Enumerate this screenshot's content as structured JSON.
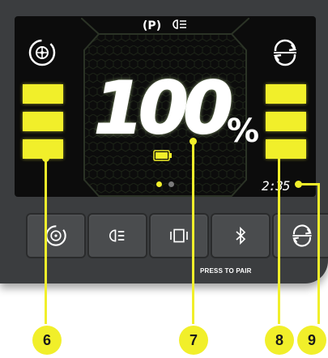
{
  "status": {
    "park": "(P)",
    "light_icon": "headlight-icon"
  },
  "battery": {
    "percent_digits": "100",
    "percent_sign": "%",
    "level": 1.0
  },
  "clock": {
    "time": "2:35"
  },
  "carousel": {
    "dots": [
      {
        "active": true
      },
      {
        "active": false
      }
    ]
  },
  "buttons": [
    {
      "icon": "wheel-cycle-icon"
    },
    {
      "icon": "headlight-icon"
    },
    {
      "icon": "bracket-display-icon"
    },
    {
      "icon": "bluetooth-icon"
    },
    {
      "icon": "rotate-arrows-icon"
    }
  ],
  "pair_label": "PRESS TO PAIR",
  "callouts": [
    "6",
    "7",
    "8",
    "9"
  ],
  "colors": {
    "accent": "#f1ef2a",
    "panel": "#3b3d3f",
    "screen": "#0c0c0c",
    "text": "#ffffff"
  }
}
